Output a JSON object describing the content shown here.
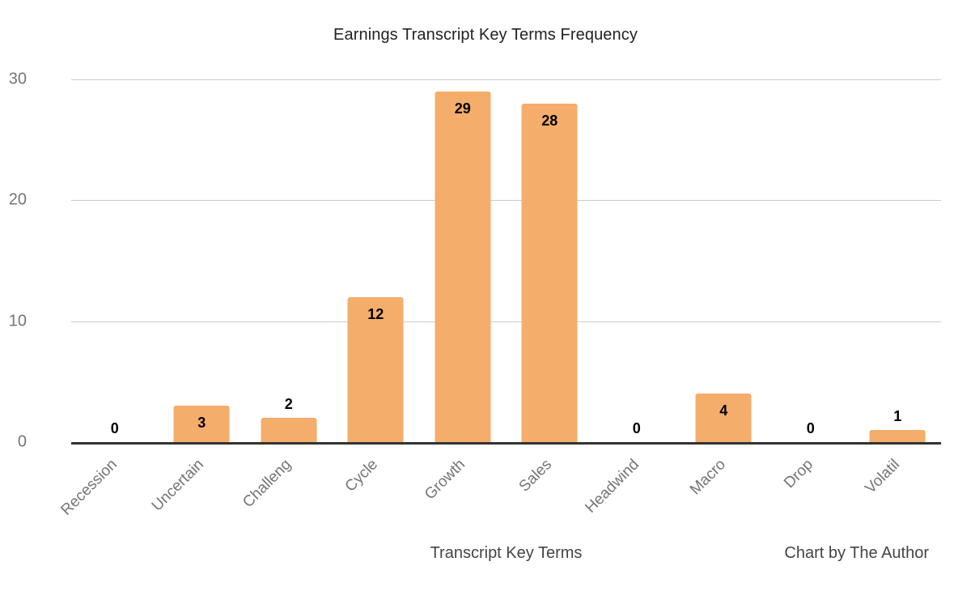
{
  "chart_data": {
    "type": "bar",
    "title": "Earnings Transcript Key Terms Frequency",
    "xlabel": "Transcript Key Terms",
    "ylabel": "",
    "categories": [
      "Recession",
      "Uncertain",
      "Challeng",
      "Cycle",
      "Growth",
      "Sales",
      "Headwind",
      "Macro",
      "Drop",
      "Volatil"
    ],
    "values": [
      0,
      3,
      2,
      12,
      29,
      28,
      0,
      4,
      0,
      1
    ],
    "value_labels": [
      "0",
      "3",
      "2",
      "12",
      "29",
      "28",
      "0",
      "4",
      "0",
      "1"
    ],
    "ylim": [
      0,
      30
    ],
    "yticks": [
      0,
      10,
      20,
      30
    ],
    "ytick_labels": [
      "0",
      "10",
      "20",
      "30"
    ],
    "grid": true,
    "legend": false,
    "bar_color": "#F4AD6B",
    "gridline_color": "#CCCCCC",
    "baseline_color": "#333333",
    "label_color": "#757575",
    "data_label_color": "#000000",
    "attribution": "Chart by The Author"
  }
}
